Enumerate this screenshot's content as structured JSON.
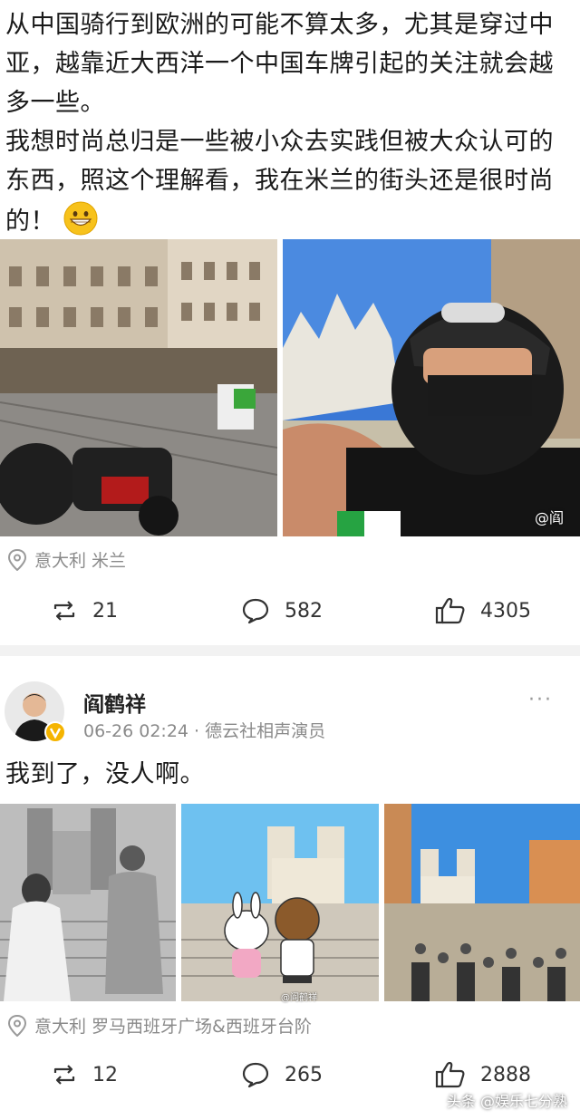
{
  "post1": {
    "text": "从中国骑行到欧洲的可能不算太多，尤其是穿过中亚，越靠近大西洋一个中国车牌引起的关注就会越多一些。\n我想时尚总归是一些被小众去实践但被大众认可的东西，照这个理解看，我在米兰的街头还是很时尚的！",
    "emoji": "grinning-emoji",
    "photo_watermark": "@阎",
    "location": "意大利 米兰",
    "repost_count": "21",
    "comment_count": "582",
    "like_count": "4305"
  },
  "post2": {
    "author": "阎鹤祥",
    "meta": "06-26 02:24 · 德云社相声演员",
    "more": "···",
    "text": "我到了，没人啊。",
    "photo2_watermark": "@阎鹤祥",
    "location": "意大利 罗马西班牙广场&西班牙台阶",
    "repost_count": "12",
    "comment_count": "265",
    "like_count": "2888"
  },
  "page_watermark": "头条 @娱乐七分熟",
  "colors": {
    "divider": "#f2f2f2",
    "meta": "#8a8a8a",
    "verified": "#f5b400"
  }
}
